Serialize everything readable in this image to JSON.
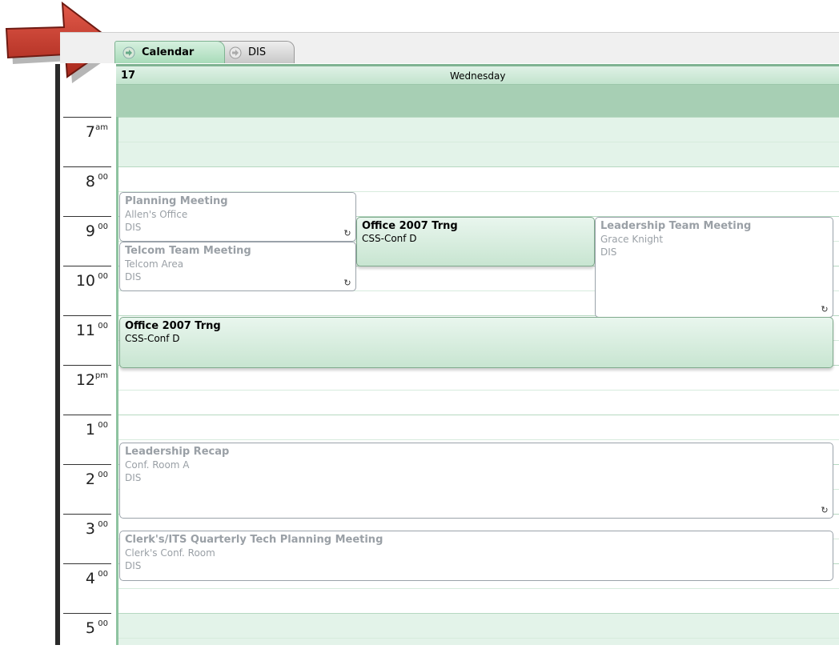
{
  "tabs": [
    {
      "label": "Calendar",
      "icon": "arrow-right-icon",
      "active": true
    },
    {
      "label": "DIS",
      "icon": "arrow-right-icon",
      "active": false
    }
  ],
  "day": {
    "number": "17",
    "name": "Wednesday"
  },
  "times": [
    {
      "hour": "7",
      "suffix": "am"
    },
    {
      "hour": "8",
      "suffix": "00"
    },
    {
      "hour": "9",
      "suffix": "00"
    },
    {
      "hour": "10",
      "suffix": "00"
    },
    {
      "hour": "11",
      "suffix": "00"
    },
    {
      "hour": "12",
      "suffix": "pm"
    },
    {
      "hour": "1",
      "suffix": "00"
    },
    {
      "hour": "2",
      "suffix": "00"
    },
    {
      "hour": "3",
      "suffix": "00"
    },
    {
      "hour": "4",
      "suffix": "00"
    },
    {
      "hour": "5",
      "suffix": "00"
    }
  ],
  "appointments": [
    {
      "title": "Planning Meeting",
      "location": "Allen's Office",
      "organizer": "DIS",
      "recurring": true,
      "status": "free"
    },
    {
      "title": "Telcom Team Meeting",
      "location": "Telcom Area",
      "organizer": "DIS",
      "recurring": true,
      "status": "free"
    },
    {
      "title": "Office 2007 Trng",
      "location": "CSS-Conf D",
      "organizer": "",
      "recurring": false,
      "status": "busy"
    },
    {
      "title": "Leadership Team Meeting",
      "location": "Grace Knight",
      "organizer": "DIS",
      "recurring": true,
      "status": "free"
    },
    {
      "title": "Office 2007 Trng",
      "location": "CSS-Conf D",
      "organizer": "",
      "recurring": false,
      "status": "busy"
    },
    {
      "title": "Leadership Recap",
      "location": "Conf. Room A",
      "organizer": "DIS",
      "recurring": true,
      "status": "free"
    },
    {
      "title": "Clerk's/ITS Quarterly Tech Planning Meeting",
      "location": "Clerk's Conf. Room",
      "organizer": "DIS",
      "recurring": false,
      "status": "free"
    }
  ],
  "colors": {
    "accent": "#a7cfb4",
    "arrow": "#c0392b"
  },
  "icons": {
    "recurring": "recurrence-icon",
    "pointer": "red-arrow-icon"
  }
}
